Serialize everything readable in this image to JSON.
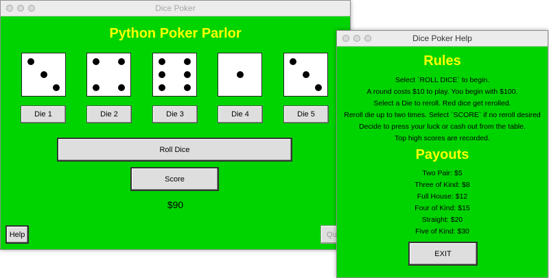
{
  "main_window": {
    "title": "Dice Poker",
    "heading": "Python Poker Parlor",
    "dice": [
      {
        "label": "Die 1",
        "value": 3
      },
      {
        "label": "Die 2",
        "value": 4
      },
      {
        "label": "Die 3",
        "value": 6
      },
      {
        "label": "Die 4",
        "value": 1
      },
      {
        "label": "Die 5",
        "value": 3
      }
    ],
    "roll_label": "Roll Dice",
    "score_label": "Score",
    "money": "$90",
    "help_label": "Help",
    "quit_label": "Qui"
  },
  "help_window": {
    "title": "Dice Poker Help",
    "rules_heading": "Rules",
    "rules": [
      "Select `ROLL DICE` to begin.",
      "A round costs $10 to play. You begin with $100.",
      "Select a Die to reroll. Red dice get rerolled.",
      "Reroll die up to two times. Select `SCORE` if no reroll desired",
      "Decide to press your luck or cash out from the table.",
      "Top high scores are recorded."
    ],
    "payouts_heading": "Payouts",
    "payouts": [
      "Two Pair: $5",
      "Three of Kind: $8",
      "Full House: $12",
      "Four of Kind: $15",
      "Straight: $20",
      "Five of Kind: $30"
    ],
    "exit_label": "EXIT"
  },
  "colors": {
    "background": "#00d400",
    "heading": "#ffff00"
  }
}
